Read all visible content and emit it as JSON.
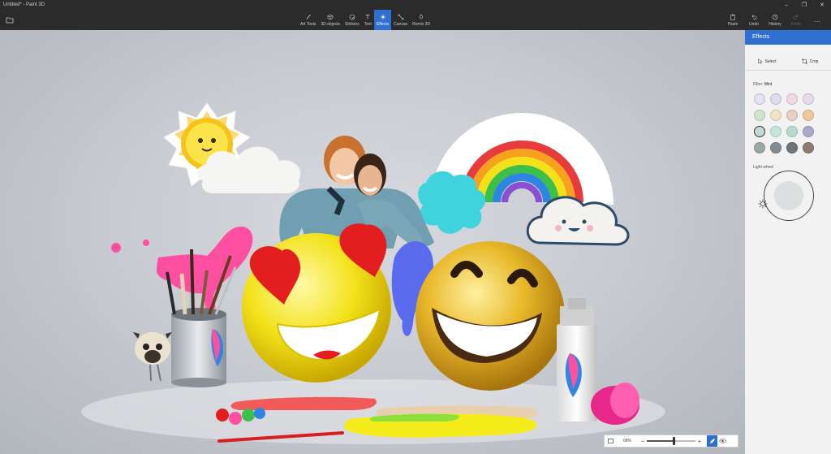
{
  "app": {
    "window_title": "Untitled* - Paint 3D"
  },
  "window_controls": [
    "–",
    "❐",
    "✕"
  ],
  "toolbar": {
    "main_tools": [
      {
        "label": "Art Tools",
        "icon": "brush-icon"
      },
      {
        "label": "3D objects",
        "icon": "cube-icon"
      },
      {
        "label": "Stickers",
        "icon": "sticker-icon"
      },
      {
        "label": "Text",
        "icon": "text-icon"
      },
      {
        "label": "Effects",
        "icon": "effects-icon",
        "active": true
      },
      {
        "label": "Canvas",
        "icon": "canvas-icon"
      },
      {
        "label": "Remix 3D",
        "icon": "remix-icon"
      }
    ],
    "right_tools": [
      {
        "label": "Paste",
        "icon": "paste-icon"
      },
      {
        "label": "Undo",
        "icon": "undo-icon"
      },
      {
        "label": "History",
        "icon": "history-icon"
      },
      {
        "label": "Redo",
        "icon": "redo-icon",
        "disabled": true
      },
      {
        "label": "…",
        "icon": "more-icon"
      }
    ]
  },
  "panel": {
    "title": "Effects",
    "select_label": "Select",
    "crop_label": "Crop",
    "filter_label": "Filter:",
    "filter_value": "Mint",
    "swatches": [
      "#e4e2ec",
      "#dcdcef",
      "#efd9e2",
      "#e7dbec",
      "#cfe6cc",
      "#efe4c5",
      "#e9cfc4",
      "#eec99a",
      "#c2dbd6",
      "#c4e6df",
      "#b7dccd",
      "#a9aac9",
      "#9aa8a1",
      "#828b92",
      "#6e7479",
      "#8e7a6e"
    ],
    "selected_swatch": 8,
    "light_wheel_label": "Light wheel",
    "accent_color": "#2f6fd0"
  },
  "zoom": {
    "percent_label": "68%",
    "level": 0.55
  }
}
